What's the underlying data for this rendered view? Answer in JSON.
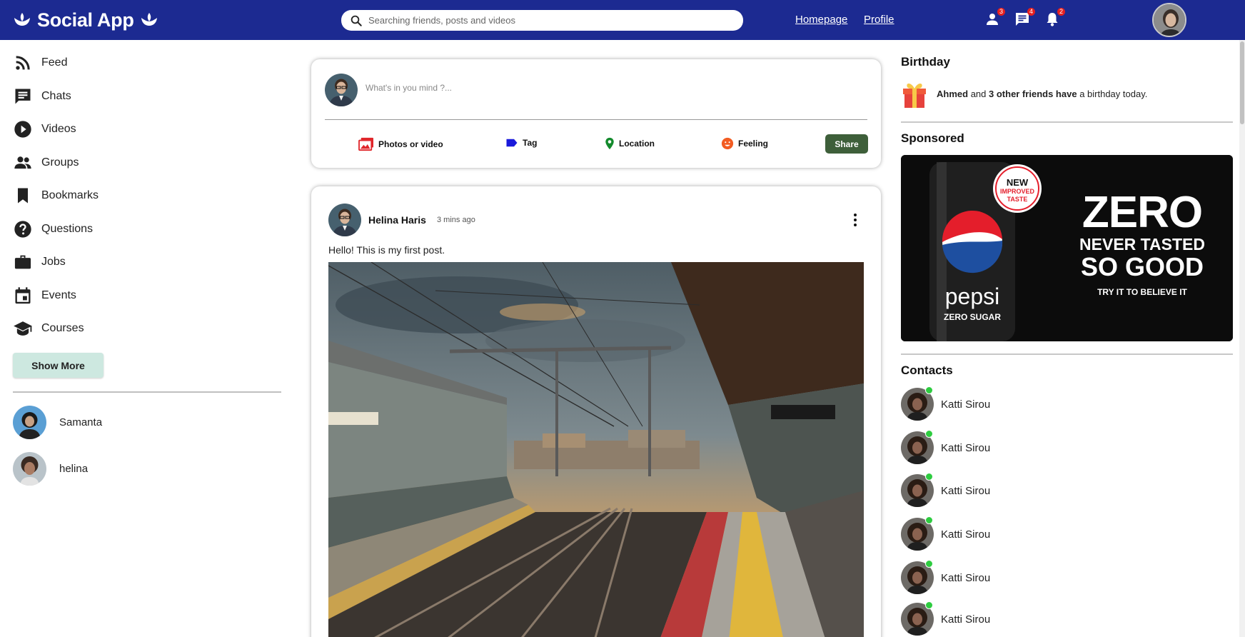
{
  "app": {
    "title": "Social App"
  },
  "search": {
    "placeholder": "Searching friends, posts and videos"
  },
  "header": {
    "links": [
      "Homepage",
      "Profile"
    ],
    "icons": [
      {
        "name": "friend-requests-icon",
        "badge": "3"
      },
      {
        "name": "messages-icon",
        "badge": "4"
      },
      {
        "name": "notifications-icon",
        "badge": "2"
      }
    ]
  },
  "sidebar": {
    "items": [
      {
        "label": "Feed",
        "icon": "rss-icon"
      },
      {
        "label": "Chats",
        "icon": "chat-icon"
      },
      {
        "label": "Videos",
        "icon": "play-circle-icon"
      },
      {
        "label": "Groups",
        "icon": "group-icon"
      },
      {
        "label": "Bookmarks",
        "icon": "bookmark-icon"
      },
      {
        "label": "Questions",
        "icon": "help-circle-icon"
      },
      {
        "label": "Jobs",
        "icon": "briefcase-icon"
      },
      {
        "label": "Events",
        "icon": "calendar-icon"
      },
      {
        "label": "Courses",
        "icon": "school-icon"
      }
    ],
    "show_more": "Show More",
    "friends": [
      {
        "name": "Samanta"
      },
      {
        "name": "helina"
      }
    ]
  },
  "composer": {
    "placeholder": "What's in you mind ?...",
    "options": [
      {
        "label": "Photos or video",
        "icon": "photo-icon",
        "color": "#e0262b"
      },
      {
        "label": "Tag",
        "icon": "tag-icon",
        "color": "#1a1adb"
      },
      {
        "label": "Location",
        "icon": "location-pin-icon",
        "color": "#138a2c"
      },
      {
        "label": "Feeling",
        "icon": "emoji-icon",
        "color": "#f25c22"
      }
    ],
    "share": "Share",
    "share_color": "#3e5f3a"
  },
  "post": {
    "author": "Helina Haris",
    "time": "3 mins ago",
    "text": "Hello! This is my first post."
  },
  "right": {
    "birthday_title": "Birthday",
    "birthday": {
      "name": "Ahmed",
      "and": "and",
      "others": "3 other friends have",
      "suffix": "a birthday today."
    },
    "sponsored_title": "Sponsored",
    "ad": {
      "badge_top": "NEW",
      "badge_mid": "IMPROVED",
      "badge_bottom": "TASTE",
      "brand": "pepsi",
      "variant": "ZERO SUGAR",
      "headline1": "ZERO",
      "headline2": "NEVER TASTED",
      "headline3": "SO GOOD",
      "tagline": "TRY IT TO BELIEVE IT"
    },
    "contacts_title": "Contacts",
    "contacts": [
      {
        "name": "Katti Sirou"
      },
      {
        "name": "Katti Sirou"
      },
      {
        "name": "Katti Sirou"
      },
      {
        "name": "Katti Sirou"
      },
      {
        "name": "Katti Sirou"
      },
      {
        "name": "Katti Sirou"
      }
    ]
  },
  "colors": {
    "topbar": "#1c2a91",
    "badge": "#e62020",
    "online": "#2ecc40",
    "show_more_bg": "#cde8e0"
  }
}
